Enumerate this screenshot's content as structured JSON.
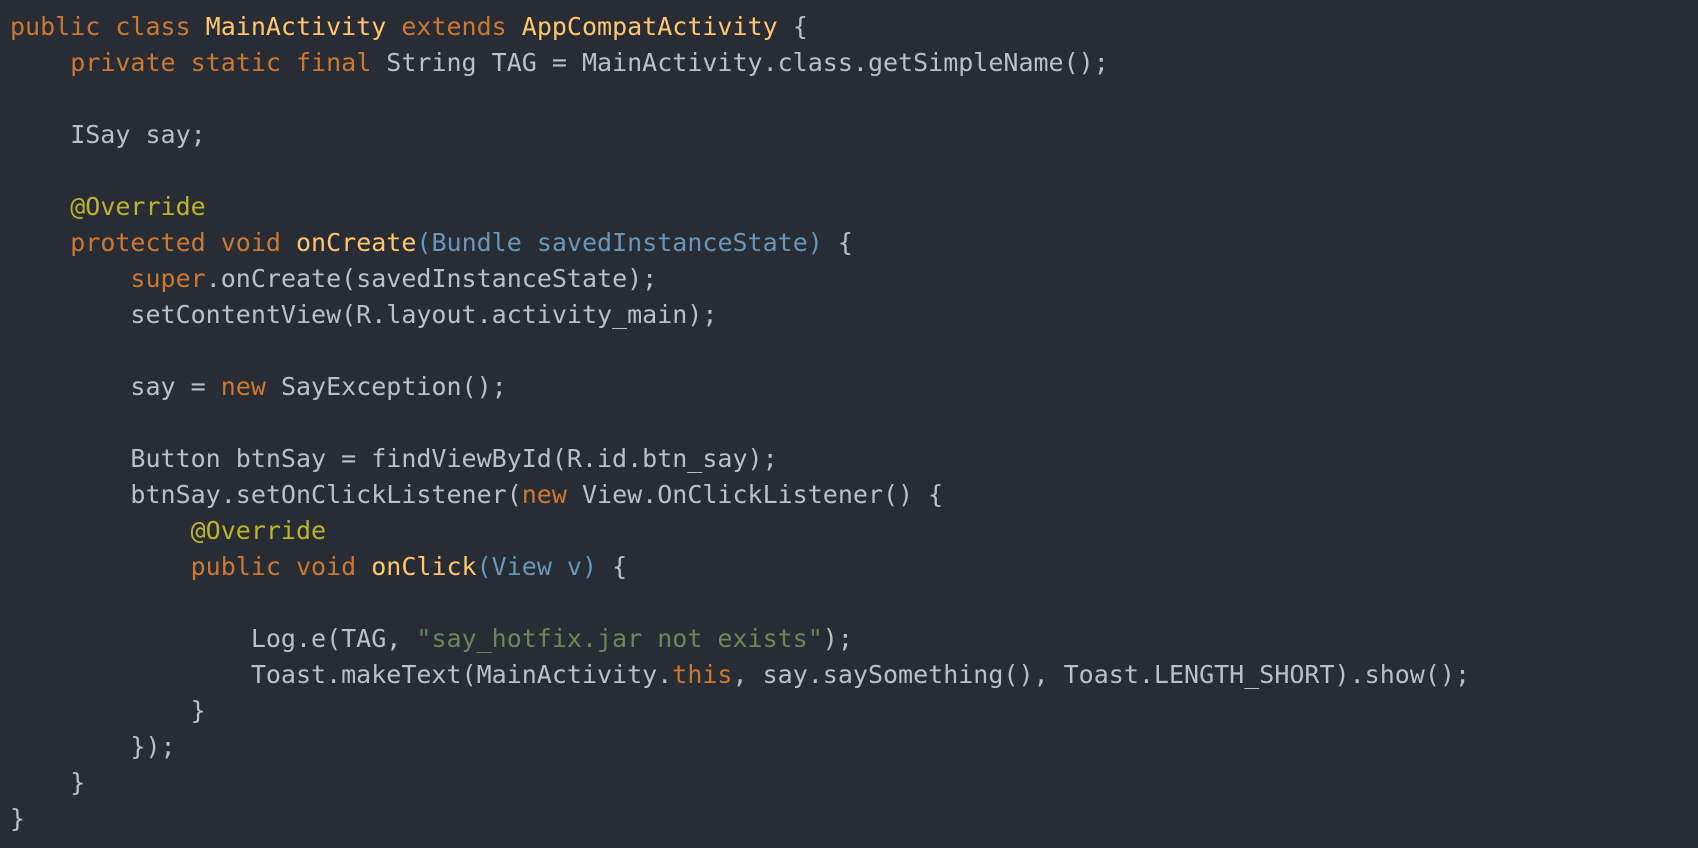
{
  "colors": {
    "background": "#282c34",
    "plain": "#b9c0c9",
    "keyword": "#cc7832",
    "class_name": "#ffc66d",
    "annotation": "#bbb529",
    "string": "#6a8759",
    "parameter": "#6897bb"
  },
  "code": {
    "lines": [
      [
        {
          "t": "kw",
          "v": "public class "
        },
        {
          "t": "cls",
          "v": "MainActivity "
        },
        {
          "t": "kw",
          "v": "extends "
        },
        {
          "t": "cls",
          "v": "AppCompatActivity "
        },
        {
          "t": "plain",
          "v": "{"
        }
      ],
      [
        {
          "t": "plain",
          "v": "    "
        },
        {
          "t": "kw",
          "v": "private static final "
        },
        {
          "t": "plain",
          "v": "String TAG = MainActivity.class.getSimpleName();"
        }
      ],
      [],
      [
        {
          "t": "plain",
          "v": "    ISay say;"
        }
      ],
      [],
      [
        {
          "t": "plain",
          "v": "    "
        },
        {
          "t": "ann",
          "v": "@Override"
        }
      ],
      [
        {
          "t": "plain",
          "v": "    "
        },
        {
          "t": "kw",
          "v": "protected void "
        },
        {
          "t": "cls",
          "v": "onCreate"
        },
        {
          "t": "param",
          "v": "(Bundle savedInstanceState) "
        },
        {
          "t": "plain",
          "v": "{"
        }
      ],
      [
        {
          "t": "plain",
          "v": "        "
        },
        {
          "t": "kw",
          "v": "super"
        },
        {
          "t": "plain",
          "v": ".onCreate(savedInstanceState);"
        }
      ],
      [
        {
          "t": "plain",
          "v": "        setContentView(R.layout.activity_main);"
        }
      ],
      [],
      [
        {
          "t": "plain",
          "v": "        say = "
        },
        {
          "t": "kw",
          "v": "new "
        },
        {
          "t": "plain",
          "v": "SayException();"
        }
      ],
      [],
      [
        {
          "t": "plain",
          "v": "        Button btnSay = findViewById(R.id.btn_say);"
        }
      ],
      [
        {
          "t": "plain",
          "v": "        btnSay.setOnClickListener("
        },
        {
          "t": "kw",
          "v": "new "
        },
        {
          "t": "plain",
          "v": "View.OnClickListener() {"
        }
      ],
      [
        {
          "t": "plain",
          "v": "            "
        },
        {
          "t": "ann",
          "v": "@Override"
        }
      ],
      [
        {
          "t": "plain",
          "v": "            "
        },
        {
          "t": "kw",
          "v": "public void "
        },
        {
          "t": "cls",
          "v": "onClick"
        },
        {
          "t": "param",
          "v": "(View v) "
        },
        {
          "t": "plain",
          "v": "{"
        }
      ],
      [],
      [
        {
          "t": "plain",
          "v": "                Log.e(TAG, "
        },
        {
          "t": "str",
          "v": "\"say_hotfix.jar not exists\""
        },
        {
          "t": "plain",
          "v": ");"
        }
      ],
      [
        {
          "t": "plain",
          "v": "                Toast.makeText(MainActivity."
        },
        {
          "t": "kw",
          "v": "this"
        },
        {
          "t": "plain",
          "v": ", say.saySomething(), Toast.LENGTH_SHORT).show();"
        }
      ],
      [
        {
          "t": "plain",
          "v": "            }"
        }
      ],
      [
        {
          "t": "plain",
          "v": "        });"
        }
      ],
      [
        {
          "t": "plain",
          "v": "    }"
        }
      ],
      [
        {
          "t": "plain",
          "v": "}"
        }
      ]
    ]
  }
}
